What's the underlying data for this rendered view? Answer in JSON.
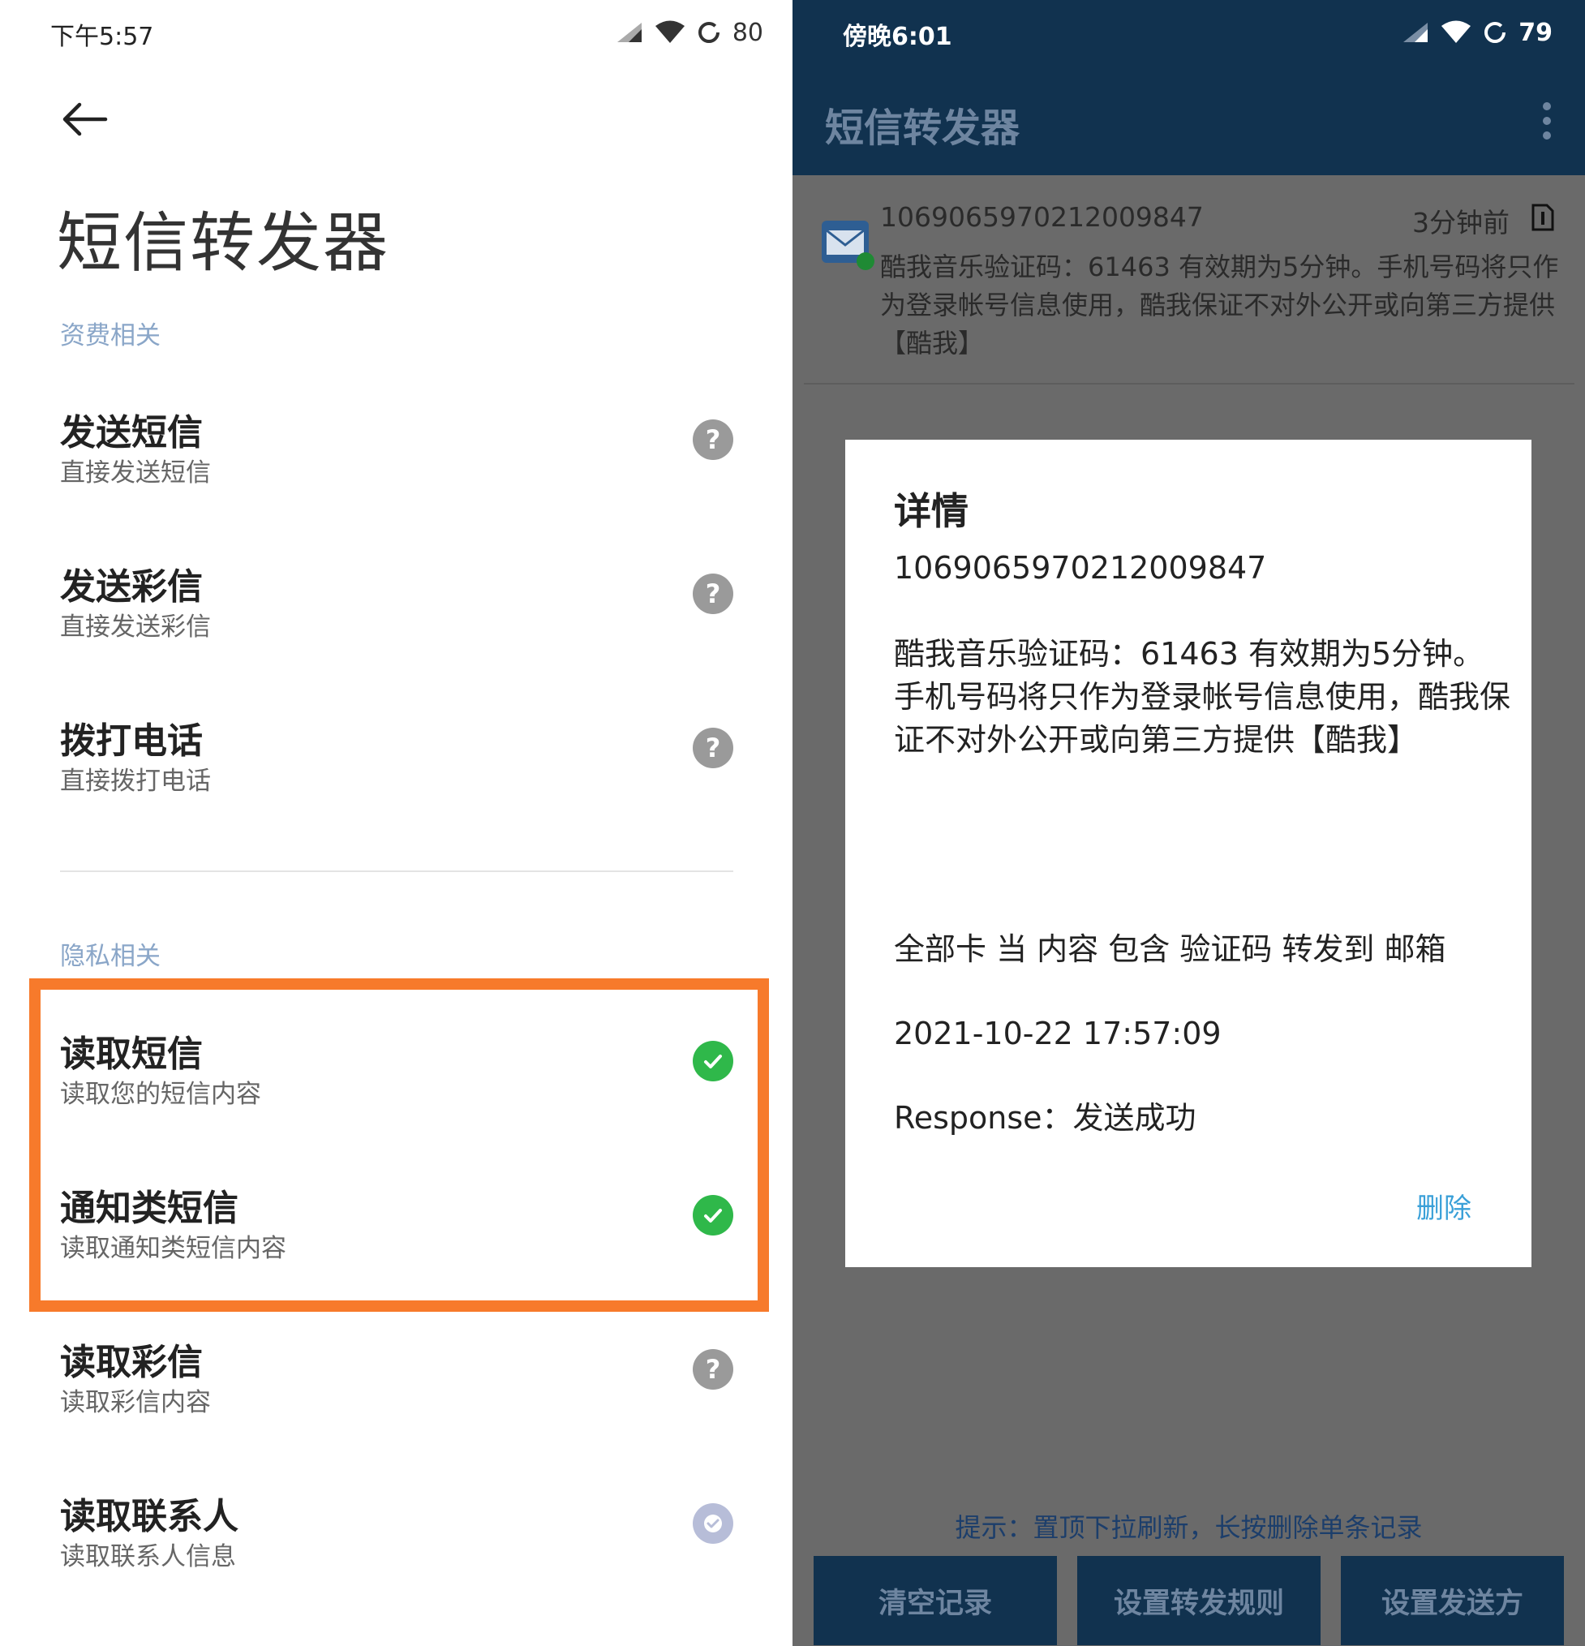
{
  "left": {
    "status": {
      "time": "下午5:57",
      "battery": "80"
    },
    "title": "短信转发器",
    "sections": [
      {
        "label": "资费相关",
        "items": [
          {
            "title": "发送短信",
            "subtitle": "直接发送短信",
            "state": "unknown"
          },
          {
            "title": "发送彩信",
            "subtitle": "直接发送彩信",
            "state": "unknown"
          },
          {
            "title": "拨打电话",
            "subtitle": "直接拨打电话",
            "state": "unknown"
          }
        ]
      },
      {
        "label": "隐私相关",
        "items": [
          {
            "title": "读取短信",
            "subtitle": "读取您的短信内容",
            "state": "granted"
          },
          {
            "title": "通知类短信",
            "subtitle": "读取通知类短信内容",
            "state": "granted"
          },
          {
            "title": "读取彩信",
            "subtitle": "读取彩信内容",
            "state": "unknown"
          },
          {
            "title": "读取联系人",
            "subtitle": "读取联系人信息",
            "state": "granted-light"
          }
        ]
      }
    ],
    "icons": {
      "unknown": "question-icon",
      "granted": "check-icon"
    },
    "colors": {
      "highlight": "#f77a2b",
      "granted": "#2fb84a",
      "unknown": "#9a9a9a"
    }
  },
  "right": {
    "status": {
      "time": "傍晚6:01",
      "battery": "79"
    },
    "app_title": "短信转发器",
    "message": {
      "sender": "1069065970212009847",
      "time": "3分钟前",
      "body": "酷我音乐验证码：61463 有效期为5分钟。手机号码将只作为登录帐号信息使用，酷我保证不对外公开或向第三方提供【酷我】"
    },
    "dialog": {
      "title": "详情",
      "sender": "1069065970212009847",
      "body": "酷我音乐验证码：61463 有效期为5分钟。手机号码将只作为登录帐号信息使用，酷我保证不对外公开或向第三方提供【酷我】",
      "rule": "全部卡 当 内容 包含 验证码 转发到 邮箱",
      "datetime": "2021-10-22 17:57:09",
      "response": "Response：发送成功",
      "delete_label": "删除"
    },
    "hint": "提示：置顶下拉刷新，长按删除单条记录",
    "buttons": {
      "clear": "清空记录",
      "rules": "设置转发规则",
      "senders": "设置发送方"
    },
    "colors": {
      "header": "#11324f",
      "accent": "#3aa0d8"
    }
  }
}
